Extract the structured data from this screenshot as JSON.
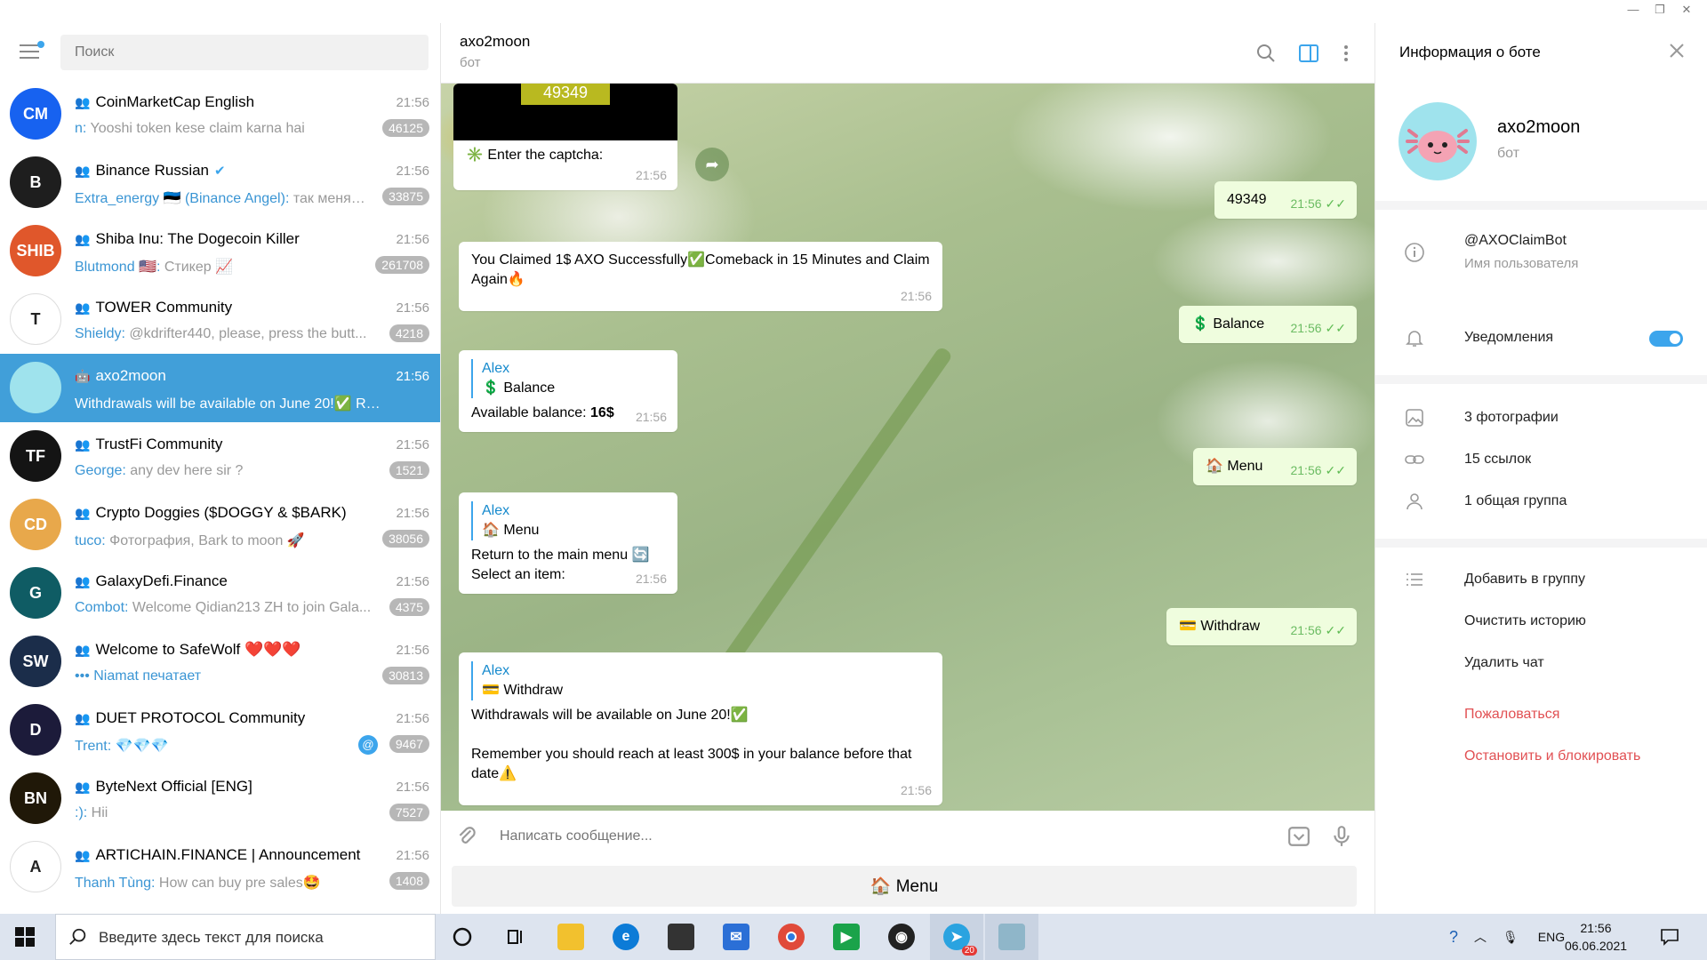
{
  "window": {
    "controls": [
      "—",
      "❐",
      "✕"
    ]
  },
  "sidebar": {
    "search_placeholder": "Поиск",
    "chats": [
      {
        "name": "CoinMarketCap English",
        "time": "21:56",
        "sender": "n:",
        "preview": "Yooshi token kese claim karna hai",
        "badge": "46125",
        "avatar_color": "#1762f0",
        "avatar_text": "CM"
      },
      {
        "name": "Binance Russian",
        "verified": true,
        "time": "21:56",
        "sender": "Extra_energy 🇪🇪 (Binance Angel):",
        "preview": "так меня…",
        "badge": "33875",
        "avatar_color": "#1e1e1e",
        "avatar_text": "B"
      },
      {
        "name": "Shiba Inu: The Dogecoin Killer",
        "time": "21:56",
        "sender": "Blutmond 🇺🇸:",
        "preview": "Стикер 📈",
        "badge": "261708",
        "avatar_color": "#e0572b",
        "avatar_text": "SHIB"
      },
      {
        "name": "TOWER Community",
        "time": "21:56",
        "sender": "Shieldy:",
        "preview": "@kdrifter440, please, press the butt...",
        "badge": "4218",
        "avatar_color": "#ffffff",
        "avatar_text": "T"
      },
      {
        "name": "axo2moon",
        "bot": true,
        "time": "21:56",
        "sender": "",
        "preview": "Withdrawals will be available on June 20!✅ Reme...",
        "badge": "",
        "avatar_color": "#9fe3ed",
        "avatar_text": "",
        "active": true
      },
      {
        "name": "TrustFi Community",
        "time": "21:56",
        "sender": "George:",
        "preview": "any dev here sir ?",
        "badge": "1521",
        "avatar_color": "#141414",
        "avatar_text": "TF"
      },
      {
        "name": "Crypto Doggies ($DOGGY & $BARK)",
        "time": "21:56",
        "sender": "tuco:",
        "preview": "Фотография, Bark to moon 🚀",
        "sender_inline": "Фотография,",
        "badge": "38056",
        "avatar_color": "#e8a84b",
        "avatar_text": "CD"
      },
      {
        "name": "GalaxyDefi.Finance",
        "time": "21:56",
        "sender": "Combot:",
        "preview": "Welcome Qidian213 ZH to join Gala...",
        "badge": "4375",
        "avatar_color": "#0f5c64",
        "avatar_text": "G"
      },
      {
        "name": "Welcome to SafeWolf ❤️❤️❤️",
        "time": "21:56",
        "sender": "••• Niamat печатает",
        "preview": "",
        "badge": "30813",
        "avatar_color": "#1b2d4a",
        "avatar_text": "SW"
      },
      {
        "name": "DUET PROTOCOL Community",
        "time": "21:56",
        "sender": "Trent:",
        "preview": "💎💎💎",
        "badge": "9467",
        "mention": "@",
        "avatar_color": "#1c1b3a",
        "avatar_text": "D"
      },
      {
        "name": "ByteNext Official [ENG]",
        "time": "21:56",
        "sender": ":):",
        "preview": "Hii",
        "badge": "7527",
        "avatar_color": "#201808",
        "avatar_text": "BN"
      },
      {
        "name": "ARTICHAIN.FINANCE | Announcement",
        "time": "21:56",
        "sender": "Thanh Tùng:",
        "preview": "How can buy pre sales🤩",
        "badge": "1408",
        "avatar_color": "#ffffff",
        "avatar_text": "A"
      }
    ]
  },
  "chat": {
    "title": "axo2moon",
    "subtitle": "бот",
    "captcha_image_text": "49349",
    "messages": {
      "captcha_prompt": "✳️ Enter the captcha:",
      "captcha_time": "21:56",
      "out_captcha": "49349",
      "out_captcha_time": "21:56",
      "claimed": "You Claimed 1$ AXO Successfully✅Comeback in 15 Minutes and Claim Again🔥",
      "claimed_time": "21:56",
      "out_balance": "💲 Balance",
      "out_balance_time": "21:56",
      "balance_reply_name": "Alex",
      "balance_reply_text": "💲 Balance",
      "balance_label": "Available balance:",
      "balance_value": "16$",
      "balance_time": "21:56",
      "out_menu": "🏠 Menu",
      "out_menu_time": "21:56",
      "menu_reply_name": "Alex",
      "menu_reply_text": "🏠 Menu",
      "menu_line1": "Return to the main menu 🔄",
      "menu_line2": "Select an item:",
      "menu_time": "21:56",
      "out_withdraw": "💳 Withdraw",
      "out_withdraw_time": "21:56",
      "withdraw_reply_name": "Alex",
      "withdraw_reply_text": "💳 Withdraw",
      "withdraw_line1": "Withdrawals will be available on June 20!✅",
      "withdraw_line2": "Remember you should reach at least 300$ in your balance before that date⚠️",
      "withdraw_time": "21:56"
    },
    "composer_placeholder": "Написать сообщение...",
    "keyboard_button": "🏠 Menu"
  },
  "info_panel": {
    "title": "Информация о боте",
    "name": "axo2moon",
    "subtitle": "бот",
    "username": "@AXOClaimBot",
    "username_label": "Имя пользователя",
    "notifications": "Уведомления",
    "notifications_on": true,
    "photos": "3 фотографии",
    "links": "15 ссылок",
    "groups": "1 общая группа",
    "add_to_group": "Добавить в группу",
    "clear_history": "Очистить историю",
    "delete_chat": "Удалить чат",
    "report": "Пожаловаться",
    "block": "Остановить и блокировать"
  },
  "taskbar": {
    "search_placeholder": "Введите здесь текст для поиска",
    "telegram_badge": "20",
    "lang": "ENG",
    "time": "21:56",
    "date": "06.06.2021",
    "colors": {
      "edge": "#0c7bd7",
      "chrome": "#e04a3a",
      "telegram": "#2aa3e0",
      "store": "#333333",
      "mail": "#2b6fd6",
      "explorer": "#f2c12e"
    }
  }
}
